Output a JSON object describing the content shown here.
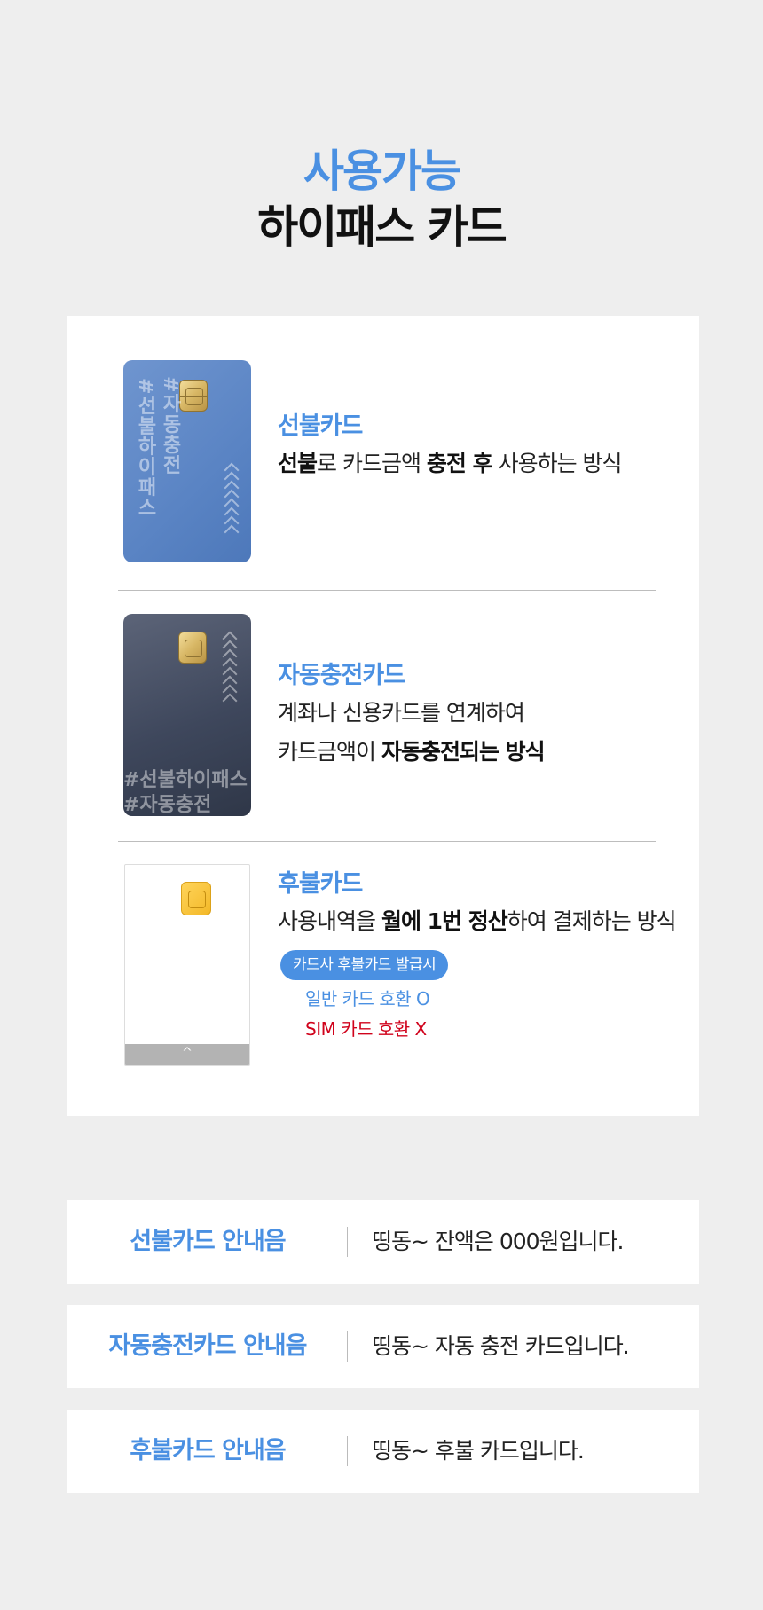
{
  "header": {
    "title_accent": "사용가능",
    "title_main": "하이패스 카드"
  },
  "cards": [
    {
      "name": "선불카드",
      "desc_1_bold": "선불",
      "desc_1_a": "로 카드금액 ",
      "desc_1_bold2": "충전 후",
      "desc_1_b": " 사용하는 방식",
      "card_text_1": "#자동충전",
      "card_text_2": "#선불하이패스"
    },
    {
      "name": "자동충전카드",
      "desc_line1": "계좌나 신용카드를 연계하여",
      "desc_line2_a": "카드금액이 ",
      "desc_line2_bold": "자동충전되는 방식",
      "card_text_1": "#선불하이패스",
      "card_text_2": "#자동충전"
    },
    {
      "name": "후불카드",
      "desc_a": "사용내역을 ",
      "desc_bold": "월에 1번 정산",
      "desc_b": "하여 결제하는 방식",
      "badge": "카드사 후불카드 발급시",
      "compat_ok": "일반 카드 호환 O",
      "compat_no": "SIM 카드 호환 X",
      "card_bar": "^"
    }
  ],
  "notices": [
    {
      "label": "선불카드 안내음",
      "message": "띵동~ 잔액은 000원입니다."
    },
    {
      "label": "자동충전카드 안내음",
      "message": "띵동~ 자동 충전 카드입니다."
    },
    {
      "label": "후불카드 안내음",
      "message": "띵동~ 후불 카드입니다."
    }
  ],
  "colors": {
    "accent": "#4a90e2",
    "warning": "#d0021b",
    "background": "#eeeeee"
  },
  "icons": [
    "ic-chip-icon",
    "chevron-up-icon"
  ]
}
